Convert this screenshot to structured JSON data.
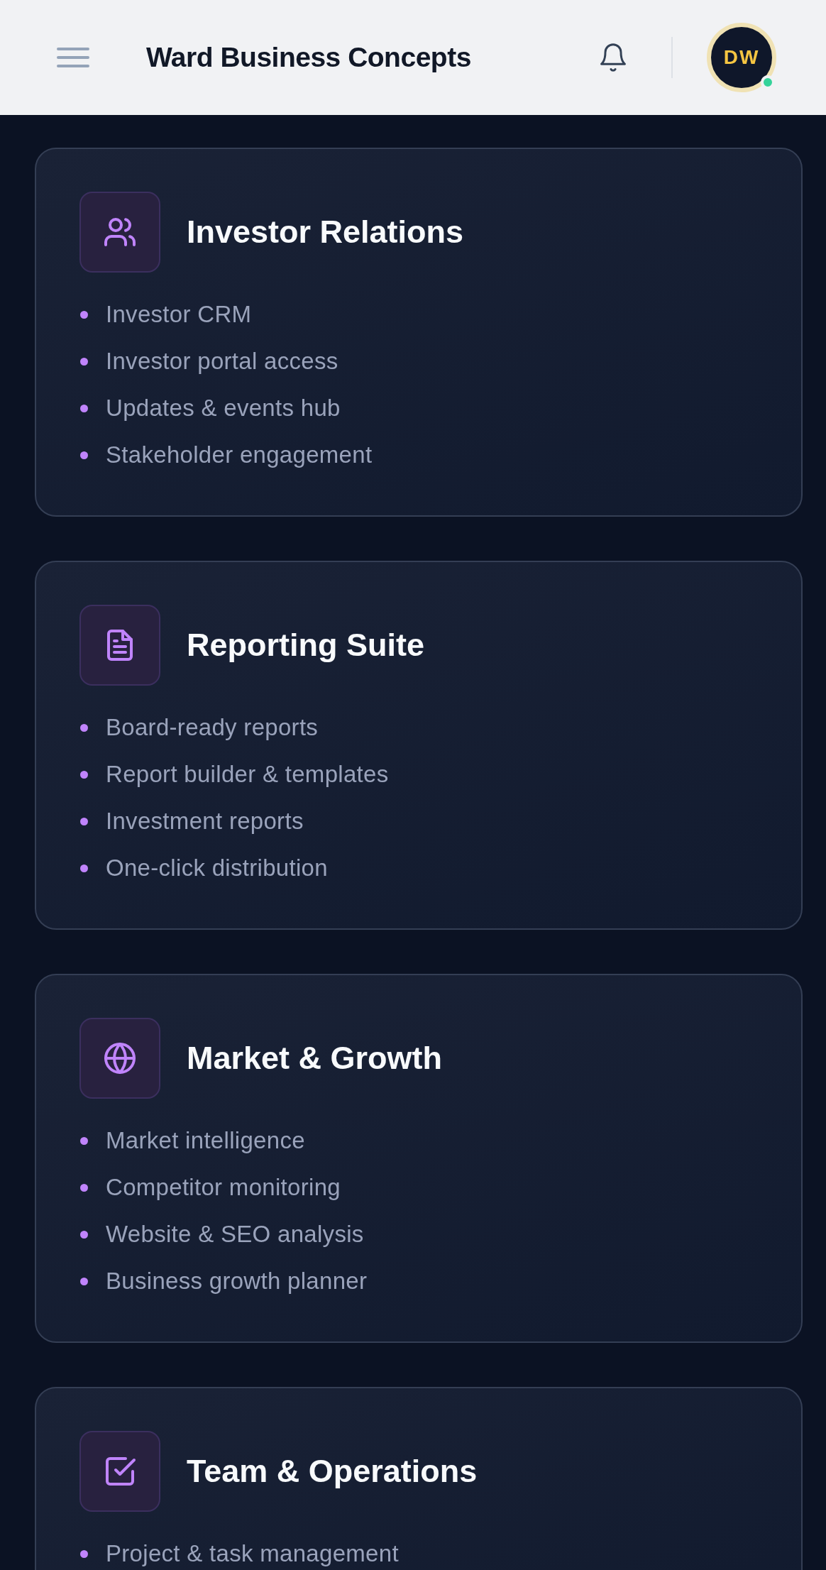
{
  "header": {
    "title": "Ward Business Concepts",
    "avatar": {
      "initials": "DW",
      "online": true
    }
  },
  "cards": [
    {
      "title": "Investor Relations",
      "items": [
        "Investor CRM",
        "Investor portal access",
        "Updates & events hub",
        "Stakeholder engagement"
      ]
    },
    {
      "title": "Reporting Suite",
      "items": [
        "Board-ready reports",
        "Report builder & templates",
        "Investment reports",
        "One-click distribution"
      ]
    },
    {
      "title": "Market & Growth",
      "items": [
        "Market intelligence",
        "Competitor monitoring",
        "Website & SEO analysis",
        "Business growth planner"
      ]
    },
    {
      "title": "Team & Operations",
      "items": [
        "Project & task management"
      ]
    }
  ]
}
